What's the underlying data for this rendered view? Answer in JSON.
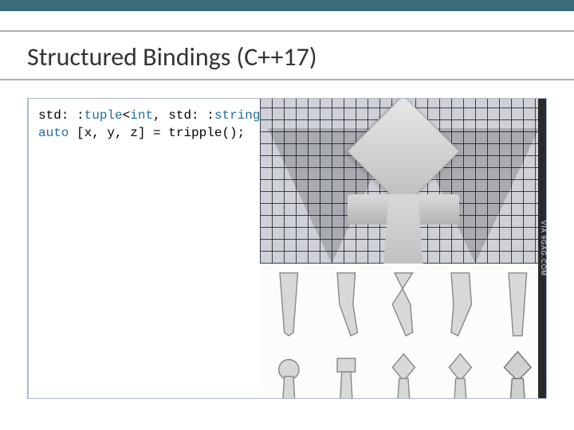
{
  "slide": {
    "title": "Structured Bindings (C++17)"
  },
  "code": {
    "line1": {
      "ns1": "std: :",
      "tuple": "tuple",
      "lt": "<",
      "int": "int",
      "comma": ", ",
      "ns2": "std: :",
      "string": "string"
    },
    "blank": " ",
    "line2": {
      "auto": "auto",
      "rest": " [x, y, z] = tripple();"
    }
  },
  "image": {
    "watermark": "VIA 9GAG.COM"
  }
}
